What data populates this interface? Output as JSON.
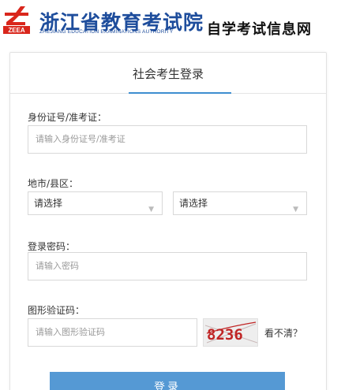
{
  "header": {
    "logo_text": "ZEEA",
    "title": "浙江省教育考试院",
    "subtitle": "ZHEJIANG EDUCATION EXAMINATIONS AUTHORITY",
    "section": "自学考试信息网"
  },
  "login": {
    "tab_label": "社会考生登录",
    "id_label": "身份证号/准考证：",
    "id_placeholder": "请输入身份证号/准考证",
    "region_label": "地市/县区：",
    "city_select": "请选择",
    "district_select": "请选择",
    "password_label": "登录密码：",
    "password_placeholder": "请输入密码",
    "captcha_label": "图形验证码：",
    "captcha_placeholder": "请输入图形验证码",
    "captcha_text": "8236",
    "refresh_label": "看不清？",
    "submit_label": "登录"
  },
  "colors": {
    "brand": "#1e4d9c",
    "logo_red": "#d9261c",
    "accent": "#3e8ed0",
    "button": "#5599d4"
  }
}
